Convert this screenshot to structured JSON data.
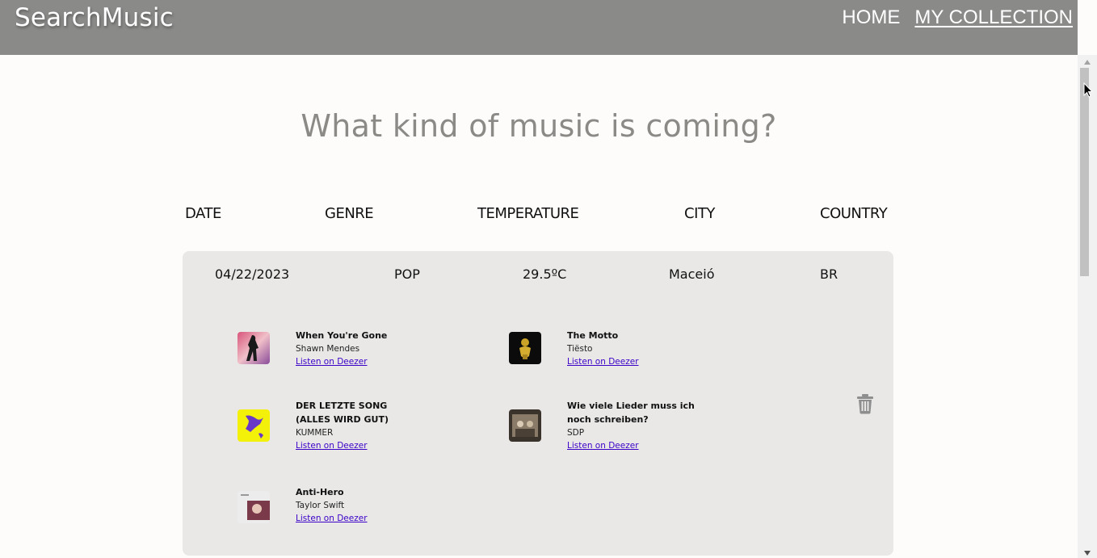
{
  "header": {
    "brand": "SearchMusic",
    "nav": [
      {
        "label": "HOME"
      },
      {
        "label": "MY COLLECTION",
        "active": true
      }
    ],
    "background": "#8a8a89"
  },
  "headline": "What kind of music is coming?",
  "table": {
    "columns": [
      "DATE",
      "GENRE",
      "TEMPERATURE",
      "CITY",
      "COUNTRY"
    ]
  },
  "entry": {
    "date": "04/22/2023",
    "genre": "POP",
    "temperature": "29.5ºC",
    "city": "Maceió",
    "country": "BR",
    "tracks": [
      {
        "title": "When You're Gone",
        "artist": "Shawn Mendes",
        "link": "Listen on Deezer"
      },
      {
        "title": "The Motto",
        "artist": "Tiësto",
        "link": "Listen on Deezer"
      },
      {
        "title": "DER LETZTE SONG (ALLES WIRD GUT)",
        "artist": "KUMMER",
        "link": "Listen on Deezer"
      },
      {
        "title": "Wie viele Lieder muss ich noch schreiben?",
        "artist": "SDP",
        "link": "Listen on Deezer"
      },
      {
        "title": "Anti-Hero",
        "artist": "Taylor Swift",
        "link": "Listen on Deezer"
      }
    ],
    "delete_icon": "trash-icon"
  }
}
